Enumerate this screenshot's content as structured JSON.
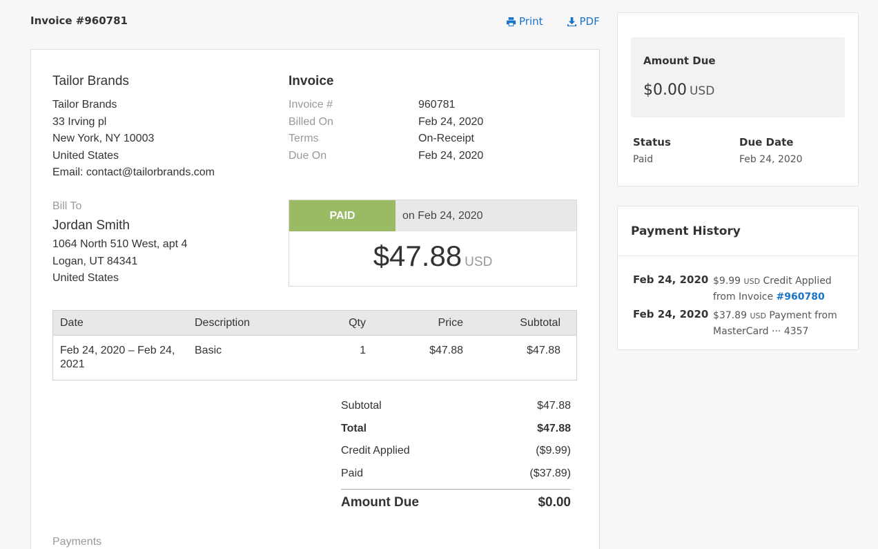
{
  "header": {
    "title": "Invoice #960781",
    "print_label": "Print",
    "pdf_label": "PDF"
  },
  "invoice": {
    "seller": {
      "name": "Tailor Brands",
      "lines": [
        "Tailor Brands",
        "33 Irving pl",
        "New York, NY 10003",
        "United States",
        "Email: contact@tailorbrands.com"
      ]
    },
    "heading": "Invoice",
    "meta": [
      {
        "label": "Invoice #",
        "value": "960781"
      },
      {
        "label": "Billed On",
        "value": "Feb 24, 2020"
      },
      {
        "label": "Terms",
        "value": "On-Receipt"
      },
      {
        "label": "Due On",
        "value": "Feb 24, 2020"
      }
    ],
    "bill_to": {
      "label": "Bill To",
      "name": "Jordan Smith",
      "lines": [
        "1064 North 510 West, apt 4",
        "Logan, UT 84341",
        "United States"
      ]
    },
    "paid_box": {
      "badge": "PAID",
      "on_text": "on Feb 24, 2020",
      "amount": "$47.88",
      "currency": "USD"
    },
    "items": {
      "headers": [
        "Date",
        "Description",
        "Qty",
        "Price",
        "Subtotal"
      ],
      "rows": [
        {
          "date": "Feb 24, 2020 – Feb 24, 2021",
          "description": "Basic",
          "qty": "1",
          "price": "$47.88",
          "subtotal": "$47.88"
        }
      ]
    },
    "totals": [
      {
        "label": "Subtotal",
        "value": "$47.88"
      },
      {
        "label": "Total",
        "value": "$47.88"
      },
      {
        "label": "Credit Applied",
        "value": "($9.99)"
      },
      {
        "label": "Paid",
        "value": "($37.89)"
      }
    ],
    "amount_due": {
      "label": "Amount Due",
      "value": "$0.00"
    },
    "payments_label": "Payments"
  },
  "summary": {
    "amount_due_title": "Amount Due",
    "amount_due_value": "$0.00",
    "amount_due_currency": "USD",
    "status_label": "Status",
    "status_value": "Paid",
    "due_date_label": "Due Date",
    "due_date_value": "Feb 24, 2020"
  },
  "payment_history": {
    "title": "Payment History",
    "items": [
      {
        "date": "Feb 24, 2020",
        "amount": "$9.99",
        "currency": "USD",
        "text": "Credit Applied from Invoice",
        "link": "#960780"
      },
      {
        "date": "Feb 24, 2020",
        "amount": "$37.89",
        "currency": "USD",
        "text": "Payment from MasterCard ··· 4357",
        "link": ""
      }
    ]
  },
  "colors": {
    "link": "#1a73c8",
    "paid_badge": "#9aba64"
  },
  "icons": {
    "print": "printer-icon",
    "pdf": "download-icon"
  }
}
